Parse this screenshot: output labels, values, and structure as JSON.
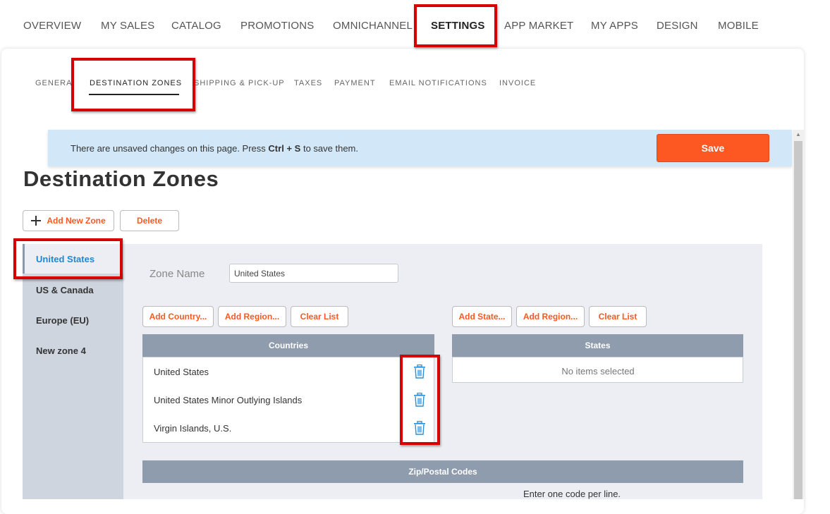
{
  "top_nav": {
    "items": [
      "OVERVIEW",
      "MY SALES",
      "CATALOG",
      "PROMOTIONS",
      "OMNICHANNEL",
      "SETTINGS",
      "APP MARKET",
      "MY APPS",
      "DESIGN",
      "MOBILE"
    ],
    "active": "SETTINGS"
  },
  "sub_nav": {
    "items": [
      "GENERAL",
      "DESTINATION ZONES",
      "SHIPPING & PICK-UP",
      "TAXES",
      "PAYMENT",
      "EMAIL NOTIFICATIONS",
      "INVOICE"
    ],
    "active": "DESTINATION ZONES"
  },
  "banner": {
    "message_prefix": "There are unsaved changes on this page. Press",
    "key1": "Ctrl",
    "plus": "+",
    "key2": "S",
    "message_suffix": "to save them.",
    "save_label": "Save"
  },
  "page": {
    "title": "Destination Zones",
    "add_zone_label": "Add New Zone",
    "delete_label": "Delete"
  },
  "zones": {
    "items": [
      "United States",
      "US & Canada",
      "Europe (EU)",
      "New zone 4"
    ],
    "active": "United States"
  },
  "zone_form": {
    "name_label": "Zone Name",
    "name_value": "United States"
  },
  "countries": {
    "buttons": [
      "Add Country...",
      "Add Region...",
      "Clear List"
    ],
    "header": "Countries",
    "rows": [
      "United States",
      "United States Minor Outlying Islands",
      "Virgin Islands, U.S."
    ]
  },
  "states": {
    "buttons": [
      "Add State...",
      "Add Region...",
      "Clear List"
    ],
    "header": "States",
    "empty_text": "No items selected"
  },
  "zip": {
    "header": "Zip/Postal Codes",
    "hint": "Enter one code per line."
  },
  "colors": {
    "accent": "#fd5722",
    "highlight": "#d60000",
    "link_active": "#1f88d0",
    "table_header": "#8e9cad",
    "banner_bg": "#d2e8f8"
  }
}
